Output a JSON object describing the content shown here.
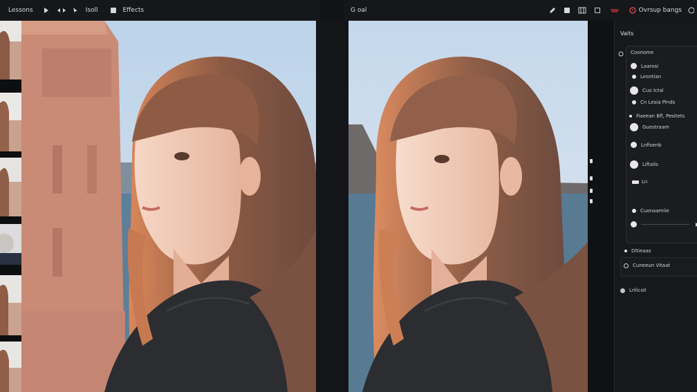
{
  "toolbar_left": {
    "label_1": "Lessons",
    "label_2": "Isoll",
    "label_3": "Effects"
  },
  "toolbar_right": {
    "title": "G oal",
    "action_label": "Ovrsup bangs"
  },
  "panel": {
    "title": "Vaits",
    "header": "Coonome",
    "items": [
      "Laarosi",
      "Leontian",
      "Cuo Ictal",
      "Cn Lesia Pinds",
      "Fiaeean Bfl, Pesitets",
      "Guestraam",
      "Lnfisenb",
      "Liftalis",
      "Ln",
      "Cuonaamiie"
    ],
    "bottom_items": [
      "Dltieaas",
      "Cuneeun Vitaat",
      "Lrilicoll"
    ]
  }
}
